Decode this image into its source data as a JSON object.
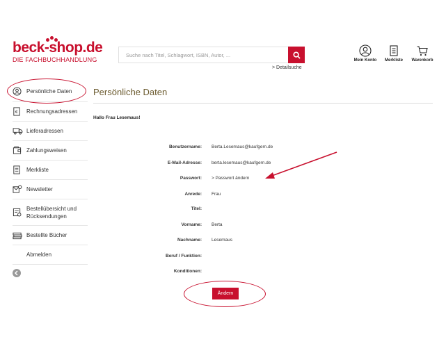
{
  "header": {
    "logo_main": "beck-shop.de",
    "logo_sub": "DIE FACHBUCHHANDLUNG",
    "search_placeholder": "Suche nach Titel, Schlagwort, ISBN, Autor, ...",
    "detail_search": "> Detailsuche",
    "icons": [
      {
        "label": "Mein Konto",
        "icon": "user-icon"
      },
      {
        "label": "Merkliste",
        "icon": "clipboard-icon"
      },
      {
        "label": "Warenkorb",
        "icon": "cart-icon"
      }
    ]
  },
  "sidebar": {
    "items": [
      {
        "label": "Persönliche Daten",
        "icon": "user-circle-icon"
      },
      {
        "label": "Rechnungsadressen",
        "icon": "invoice-icon"
      },
      {
        "label": "Lieferadressen",
        "icon": "truck-icon"
      },
      {
        "label": "Zahlungsweisen",
        "icon": "wallet-icon"
      },
      {
        "label": "Merkliste",
        "icon": "list-icon"
      },
      {
        "label": "Newsletter",
        "icon": "newsletter-icon"
      },
      {
        "label": "Bestellübersicht und Rücksendungen",
        "icon": "orders-icon"
      },
      {
        "label": "Bestellte Bücher",
        "icon": "books-icon"
      },
      {
        "label": "Abmelden",
        "icon": ""
      }
    ],
    "back_icon": "back-arrow-icon"
  },
  "main": {
    "title": "Persönliche Daten",
    "greeting": "Hallo Frau Lesemaus!",
    "fields": [
      {
        "label": "Benutzername:",
        "value": "Berta.Lesemaus@kaufgern.de"
      },
      {
        "label": "E-Mail-Adresse:",
        "value": "berta.lesemaus@kaufgern.de"
      },
      {
        "label": "Passwort:",
        "value": "> Passwort ändern"
      },
      {
        "label": "Anrede:",
        "value": "Frau"
      },
      {
        "label": "Titel:",
        "value": ""
      },
      {
        "label": "Vorname:",
        "value": "Berta"
      },
      {
        "label": "Nachname:",
        "value": "Lesemaus"
      },
      {
        "label": "Beruf / Funktion:",
        "value": ""
      },
      {
        "label": "Konditionen:",
        "value": ""
      }
    ],
    "change_button": "Ändern"
  },
  "colors": {
    "brand": "#c8102e",
    "title": "#6b5a2e"
  }
}
